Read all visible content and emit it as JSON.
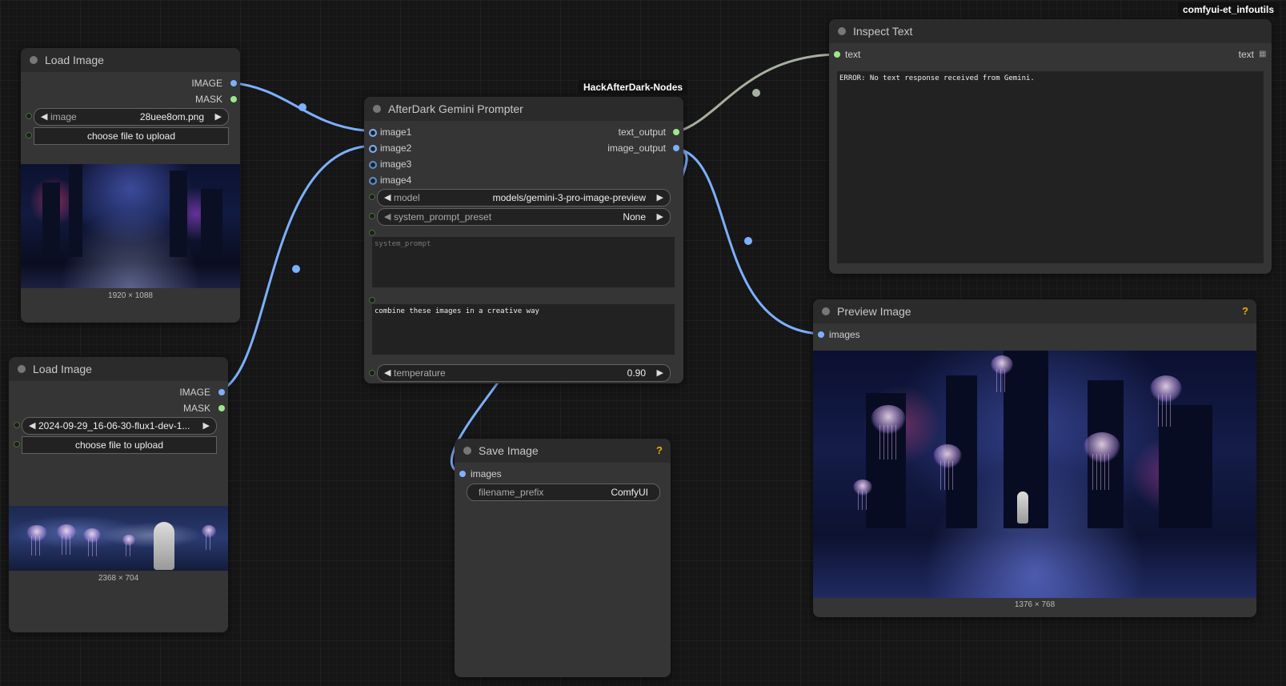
{
  "colors": {
    "image_wire": "#7db0ff",
    "text_wire": "#a7b0a0",
    "node_bg": "#353535",
    "title_bg": "#2b2b2b",
    "help": "#f0b000"
  },
  "badges": {
    "top_right": "comfyui-et_infoutils",
    "prompter_group": "HackAfterDark-Nodes"
  },
  "load_image_1": {
    "title": "Load Image",
    "outputs": [
      "IMAGE",
      "MASK"
    ],
    "image_label": "image",
    "image_value": "28uee8om.png",
    "upload_button": "choose file to upload",
    "dimensions": "1920 × 1088"
  },
  "load_image_2": {
    "title": "Load Image",
    "outputs": [
      "IMAGE",
      "MASK"
    ],
    "image_label": "image",
    "image_value": "2024-09-29_16-06-30-flux1-dev-1...",
    "upload_button": "choose file to upload",
    "dimensions": "2368 × 704"
  },
  "prompter": {
    "title": "AfterDark Gemini Prompter",
    "inputs": [
      "image1",
      "image2",
      "image3",
      "image4"
    ],
    "outputs": [
      "text_output",
      "image_output"
    ],
    "model_label": "model",
    "model_value": "models/gemini-3-pro-image-preview",
    "preset_label": "system_prompt_preset",
    "preset_value": "None",
    "system_prompt_placeholder": "system_prompt",
    "prompt_text": "combine these images in a creative way",
    "temperature_label": "temperature",
    "temperature_value": "0.90"
  },
  "save_image": {
    "title": "Save Image",
    "help": "?",
    "input": "images",
    "prefix_label": "filename_prefix",
    "prefix_value": "ComfyUI"
  },
  "inspect_text": {
    "title": "Inspect Text",
    "input": "text",
    "output": "text",
    "content": "ERROR: No text response received from Gemini."
  },
  "preview_image": {
    "title": "Preview Image",
    "help": "?",
    "input": "images",
    "dimensions": "1376 × 768"
  }
}
